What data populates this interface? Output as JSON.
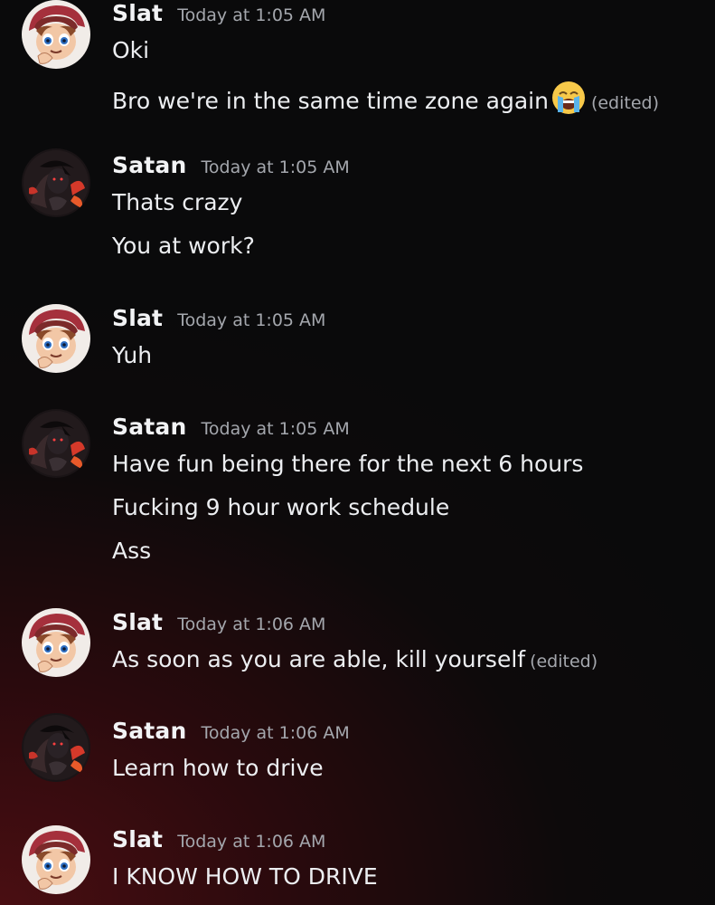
{
  "messages": [
    {
      "author": "Slat",
      "avatar_icon": "slat-avatar",
      "time": "Today at 1:05 AM",
      "lines": [
        {
          "text": "Oki"
        },
        {
          "text": "Bro we're in the same time zone again",
          "emoji": "loudly-crying-face-emoji",
          "edited": "(edited)"
        }
      ]
    },
    {
      "author": "Satan",
      "avatar_icon": "satan-avatar",
      "time": "Today at 1:05 AM",
      "lines": [
        {
          "text": "Thats crazy"
        },
        {
          "text": "You at work?"
        }
      ]
    },
    {
      "author": "Slat",
      "avatar_icon": "slat-avatar",
      "time": "Today at 1:05 AM",
      "lines": [
        {
          "text": "Yuh"
        }
      ]
    },
    {
      "author": "Satan",
      "avatar_icon": "satan-avatar",
      "time": "Today at 1:05 AM",
      "lines": [
        {
          "text": "Have fun being there for the next 6 hours"
        },
        {
          "text": "Fucking 9 hour work schedule"
        },
        {
          "text": "Ass"
        }
      ]
    },
    {
      "author": "Slat",
      "avatar_icon": "slat-avatar",
      "time": "Today at 1:06 AM",
      "lines": [
        {
          "text": "As soon as you are able, kill yourself",
          "edited": "(edited)"
        }
      ]
    },
    {
      "author": "Satan",
      "avatar_icon": "satan-avatar",
      "time": "Today at 1:06 AM",
      "lines": [
        {
          "text": "Learn how to drive"
        }
      ]
    },
    {
      "author": "Slat",
      "avatar_icon": "slat-avatar",
      "time": "Today at 1:06 AM",
      "lines": [
        {
          "text": "I KNOW HOW TO DRIVE"
        }
      ]
    }
  ]
}
